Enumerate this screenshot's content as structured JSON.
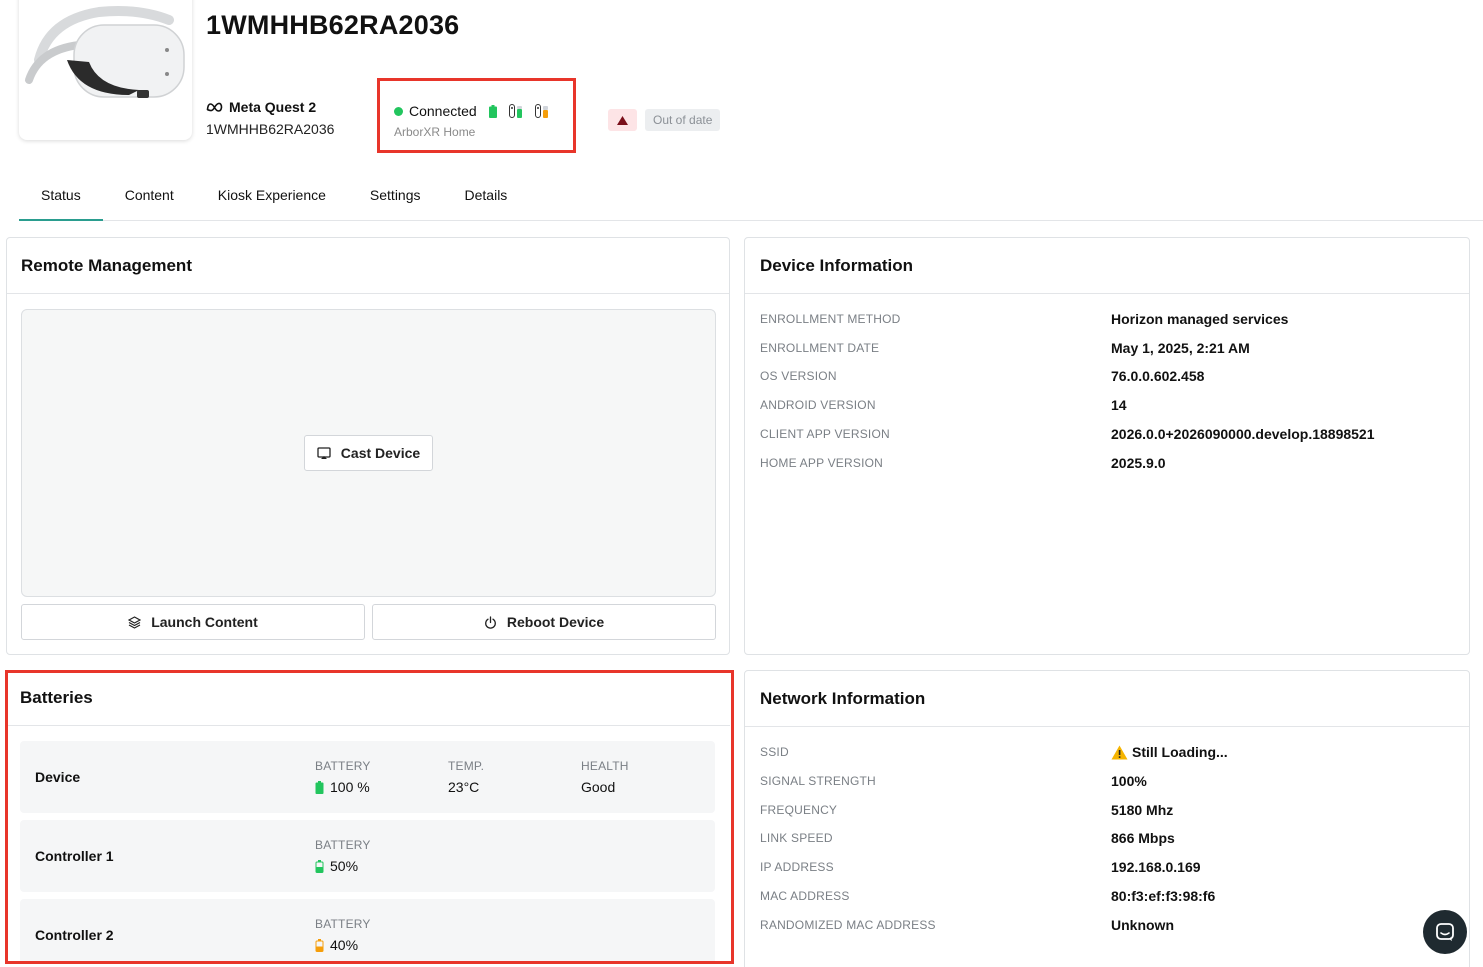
{
  "header": {
    "device_title": "1WMHHB62RA2036",
    "model_name": "Meta Quest 2",
    "serial": "1WMHHB62RA2036",
    "brand_icon": "meta-logo-icon",
    "status": {
      "label": "Connected",
      "subtitle": "ArborXR Home",
      "color": "#22c55e"
    },
    "out_of_date_label": "Out of date"
  },
  "tabs": [
    {
      "label": "Status",
      "active": true
    },
    {
      "label": "Content",
      "active": false
    },
    {
      "label": "Kiosk Experience",
      "active": false
    },
    {
      "label": "Settings",
      "active": false
    },
    {
      "label": "Details",
      "active": false
    }
  ],
  "remote_management": {
    "title": "Remote Management",
    "cast_label": "Cast Device",
    "launch_label": "Launch Content",
    "reboot_label": "Reboot Device"
  },
  "device_information": {
    "title": "Device Information",
    "rows": [
      {
        "label": "ENROLLMENT METHOD",
        "value": "Horizon managed services"
      },
      {
        "label": "ENROLLMENT DATE",
        "value": "May 1, 2025, 2:21 AM"
      },
      {
        "label": "OS VERSION",
        "value": "76.0.0.602.458"
      },
      {
        "label": "ANDROID VERSION",
        "value": "14"
      },
      {
        "label": "CLIENT APP VERSION",
        "value": "2026.0.0+2026090000.develop.18898521"
      },
      {
        "label": "HOME APP VERSION",
        "value": "2025.9.0"
      }
    ]
  },
  "batteries": {
    "title": "Batteries",
    "battery_label": "BATTERY",
    "temp_label": "TEMP.",
    "health_label": "HEALTH",
    "device": {
      "name": "Device",
      "battery": "100 %",
      "level": 100,
      "temp": "23°C",
      "health": "Good"
    },
    "controller1": {
      "name": "Controller 1",
      "battery": "50%",
      "level": 50
    },
    "controller2": {
      "name": "Controller 2",
      "battery": "40%",
      "level": 40
    }
  },
  "network_information": {
    "title": "Network Information",
    "rows": [
      {
        "label": "SSID",
        "value": "Still Loading..."
      },
      {
        "label": "SIGNAL STRENGTH",
        "value": "100%"
      },
      {
        "label": "FREQUENCY",
        "value": "5180 Mhz"
      },
      {
        "label": "LINK SPEED",
        "value": "866 Mbps"
      },
      {
        "label": "IP ADDRESS",
        "value": "192.168.0.169"
      },
      {
        "label": "MAC ADDRESS",
        "value": "80:f3:ef:f3:98:f6"
      },
      {
        "label": "RANDOMIZED MAC ADDRESS",
        "value": "Unknown"
      }
    ]
  },
  "colors": {
    "accent": "#2a9d8f",
    "highlight": "#e8352a",
    "battery_green": "#22c55e",
    "battery_orange": "#f59e0b"
  }
}
